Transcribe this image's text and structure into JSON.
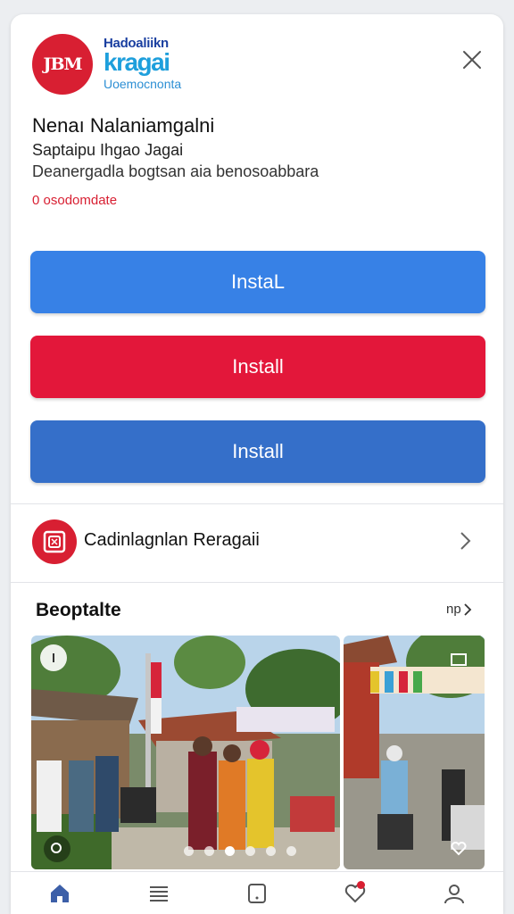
{
  "header": {
    "logo_text": "JBM",
    "brand_top": "Hadoaliikn",
    "brand_main": "kragai",
    "brand_sub": "Uoemocnonta",
    "close_icon": "close-icon"
  },
  "app": {
    "title": "Nenaı Nalaniamgalni",
    "subtitle": "Saptaipu Ihgao Jagai",
    "description": "Deanergadla bogtsan aia benosoabbara",
    "status": "0 osodomdate"
  },
  "buttons": [
    {
      "label": "InstaL",
      "color": "#3781e6"
    },
    {
      "label": "Install",
      "color": "#e3173a"
    },
    {
      "label": "Install",
      "color": "#356fc9"
    }
  ],
  "link_row": {
    "label": "Cadinlagnlan Reragaii",
    "icon": "brand-square-icon",
    "chevron": "chevron-right-icon"
  },
  "section": {
    "title": "Beoptalte",
    "more_label": "np"
  },
  "gallery": {
    "dots_total": 6,
    "active_dot": 2
  },
  "bottom_nav": {
    "items": [
      "home-icon",
      "list-icon",
      "tablet-icon",
      "heart-icon",
      "profile-icon"
    ],
    "accent": "#d81f32"
  }
}
